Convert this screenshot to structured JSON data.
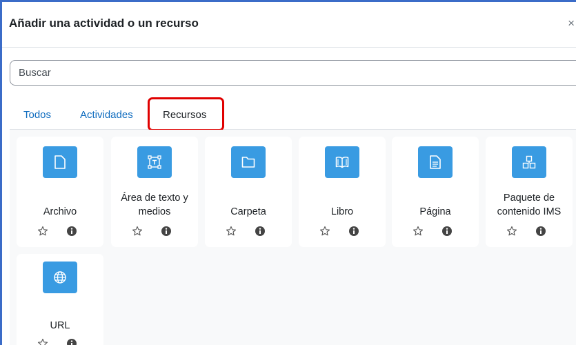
{
  "modal": {
    "title": "Añadir una actividad o un recurso",
    "close_symbol": "×"
  },
  "search": {
    "placeholder": "Buscar"
  },
  "tabs": [
    {
      "label": "Todos",
      "active": false
    },
    {
      "label": "Actividades",
      "active": false
    },
    {
      "label": "Recursos",
      "active": true
    }
  ],
  "colors": {
    "icon_background": "#399be2",
    "link": "#0f6cbf",
    "highlight": "#e00000",
    "window_border": "#3b6cc8"
  },
  "items": [
    {
      "name": "Archivo",
      "icon": "file-icon"
    },
    {
      "name": "Área de texto y medios",
      "icon": "text-area-icon"
    },
    {
      "name": "Carpeta",
      "icon": "folder-icon"
    },
    {
      "name": "Libro",
      "icon": "book-icon"
    },
    {
      "name": "Página",
      "icon": "page-icon"
    },
    {
      "name": "Paquete de contenido IMS",
      "icon": "ims-package-icon"
    },
    {
      "name": "URL",
      "icon": "globe-icon"
    }
  ]
}
